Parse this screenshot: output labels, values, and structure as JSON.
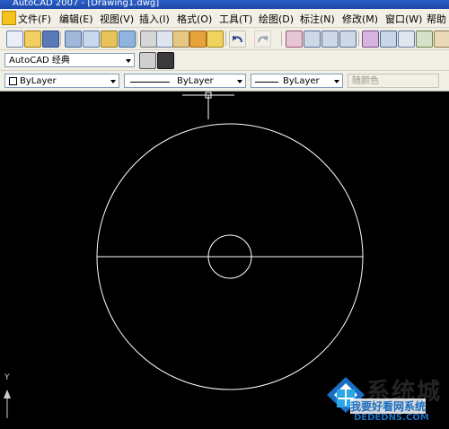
{
  "window": {
    "title": "AutoCAD 2007 - [Drawing1.dwg]"
  },
  "menu": {
    "items": [
      {
        "label": "文件(F)"
      },
      {
        "label": "编辑(E)"
      },
      {
        "label": "视图(V)"
      },
      {
        "label": "插入(I)"
      },
      {
        "label": "格式(O)"
      },
      {
        "label": "工具(T)"
      },
      {
        "label": "绘图(D)"
      },
      {
        "label": "标注(N)"
      },
      {
        "label": "修改(M)"
      },
      {
        "label": "窗口(W)"
      },
      {
        "label": "帮助"
      }
    ]
  },
  "workspace": {
    "selected": "AutoCAD 经典"
  },
  "properties": {
    "color": "ByLayer",
    "linetype": "ByLayer",
    "lineweight": "ByLayer",
    "plotstyle": "随颜色"
  },
  "ucs": {
    "y_label": "Y"
  },
  "watermark": {
    "brand": "系统城",
    "line1": "我要好看网系统",
    "line2": "DEDEDNS.COM"
  },
  "colors": {
    "title_bar": "#1d48a8",
    "toolbar_bg": "#f1efe6",
    "canvas_bg": "#000000",
    "geometry": "#ffffff",
    "watermark_blue": "#1a6fc4"
  }
}
